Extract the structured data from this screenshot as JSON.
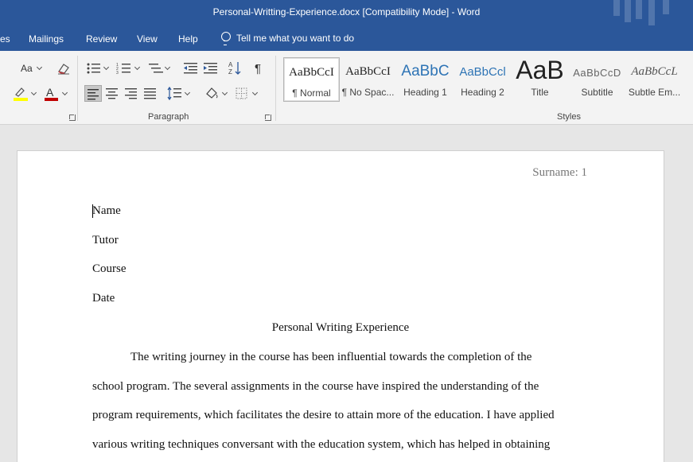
{
  "window": {
    "title": "Personal-Writting-Experience.docx [Compatibility Mode]  -  Word"
  },
  "menu": {
    "tabs": [
      "es",
      "Mailings",
      "Review",
      "View",
      "Help"
    ],
    "tell_me": "Tell me what you want to do"
  },
  "ribbon": {
    "font_size_label": "Aa",
    "paragraph_label": "Paragraph",
    "styles_label": "Styles",
    "styles": [
      {
        "preview": "AaBbCcI",
        "name": "¶ Normal"
      },
      {
        "preview": "AaBbCcI",
        "name": "¶ No Spac..."
      },
      {
        "preview": "AaBbC",
        "name": "Heading 1"
      },
      {
        "preview": "AaBbCcl",
        "name": "Heading 2"
      },
      {
        "preview": "AaB",
        "name": "Title"
      },
      {
        "preview": "AaBbCcD",
        "name": "Subtitle"
      },
      {
        "preview": "AaBbCcL",
        "name": "Subtle Em..."
      }
    ]
  },
  "document": {
    "header": "Surname: 1",
    "lines": [
      "Name",
      "Tutor",
      "Course",
      "Date"
    ],
    "heading": "Personal Writing Experience",
    "body": [
      "The writing journey in the course has been influential towards the completion of the",
      "school program. The several assignments in the course have inspired the understanding of the",
      "program requirements, which facilitates the desire to attain more of the education. I have applied",
      "various writing techniques conversant with the education system, which has helped in obtaining"
    ]
  },
  "colors": {
    "title_bar": "#2b579a",
    "ribbon_bg": "#f3f3f3",
    "doc_bg": "#e6e6e6",
    "highlight": "#ffff00",
    "font_color": "#c00000"
  }
}
